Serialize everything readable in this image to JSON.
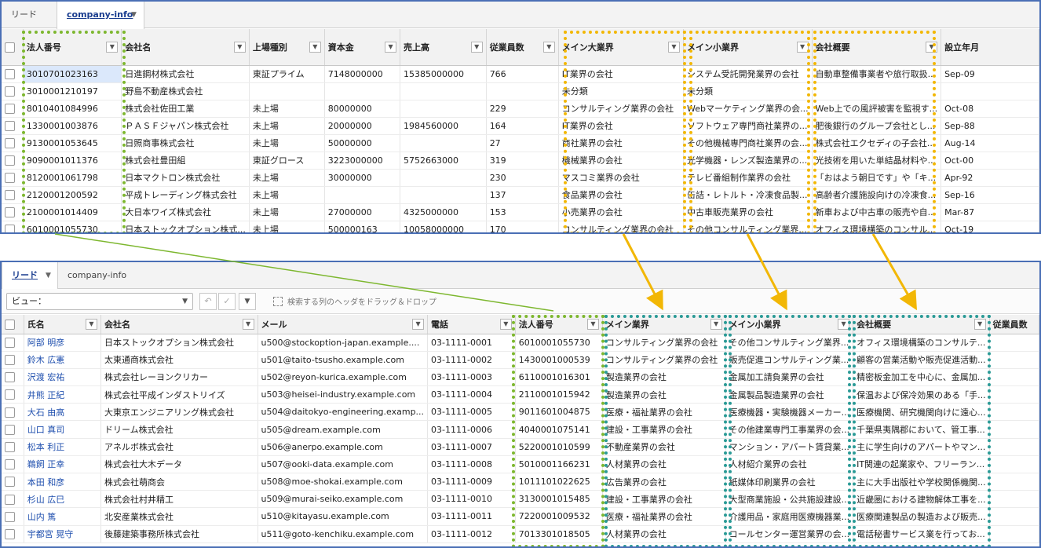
{
  "colors": {
    "green_highlight": "#7db72f",
    "yellow_highlight": "#f2b705",
    "teal_highlight": "#2a9a96",
    "panel_border": "#4a6fb5",
    "link": "#1f4fae"
  },
  "top": {
    "tabs": [
      {
        "label": "リード"
      },
      {
        "label": "company-info"
      }
    ],
    "columns": [
      "法人番号",
      "会社名",
      "上場種別",
      "資本金",
      "売上高",
      "従業員数",
      "メイン大業界",
      "メイン小業界",
      "会社概要",
      "設立年月"
    ],
    "rows": [
      [
        "3010701023163",
        "日進鋼材株式会社",
        "東証プライム",
        "7148000000",
        "15385000000",
        "766",
        "IT業界の会社",
        "システム受託開発業界の会社",
        "自動車整備事業者や旅行取扱...",
        "Sep-09"
      ],
      [
        "3010001210197",
        "野島不動産株式会社",
        "",
        "",
        "",
        "",
        "未分類",
        "未分類",
        "",
        ""
      ],
      [
        "8010401084996",
        "株式会社佐田工業",
        "未上場",
        "80000000",
        "",
        "229",
        "コンサルティング業界の会社",
        "Webマーケティング業界の会...",
        "Web上での風評被害を監視す...",
        "Oct-08"
      ],
      [
        "1330001003876",
        "ＰＡＳＦジャパン株式会社",
        "未上場",
        "20000000",
        "1984560000",
        "164",
        "IT業界の会社",
        "ソフトウェア専門商社業界の...",
        "肥後銀行のグループ会社とし...",
        "Sep-88"
      ],
      [
        "9130001053645",
        "日照商事株式会社",
        "未上場",
        "50000000",
        "",
        "27",
        "商社業界の会社",
        "その他機械専門商社業界の会...",
        "株式会社エクセディの子会社...",
        "Aug-14"
      ],
      [
        "9090001011376",
        "株式会社豊田組",
        "東証グロース",
        "3223000000",
        "5752663000",
        "319",
        "機械業界の会社",
        "光学機器・レンズ製造業界の...",
        "光技術を用いた単結晶材料や...",
        "Oct-00"
      ],
      [
        "8120001061798",
        "日本マクトロン株式会社",
        "未上場",
        "30000000",
        "",
        "230",
        "マスコミ業界の会社",
        "テレビ番組制作業界の会社",
        "「おはよう朝日です」や「キ...",
        "Apr-92"
      ],
      [
        "2120001200592",
        "平成トレーディング株式会社",
        "未上場",
        "",
        "",
        "137",
        "食品業界の会社",
        "缶詰・レトルト・冷凍食品製...",
        "高齢者介護施設向けの冷凍食...",
        "Sep-16"
      ],
      [
        "2100001014409",
        "大日本ワイズ株式会社",
        "未上場",
        "27000000",
        "4325000000",
        "153",
        "小売業界の会社",
        "中古車販売業界の会社",
        "新車および中古車の販売や自...",
        "Mar-87"
      ],
      [
        "6010001055730",
        "日本ストックオプション株式...",
        "未上場",
        "500000163",
        "10058000000",
        "170",
        "コンサルティング業界の会社",
        "その他コンサルティング業界...",
        "オフィス環境構築のコンサル...",
        "Oct-19"
      ]
    ]
  },
  "bottom": {
    "tabs": [
      {
        "label": "リード"
      },
      {
        "label": "company-info"
      }
    ],
    "view_label": "ビュー：",
    "drag_hint": "検索する列のヘッダをドラッグ＆ドロップ",
    "columns": [
      "氏名",
      "会社名",
      "メール",
      "電話",
      "法人番号",
      "メイン業界",
      "メイン小業界",
      "会社概要",
      "従業員数"
    ],
    "rows": [
      [
        "阿部 明彦",
        "日本ストックオプション株式会社",
        "u500@stockoption-japan.example....",
        "03-1111-0001",
        "6010001055730",
        "コンサルティング業界の会社",
        "その他コンサルティング業界...",
        "オフィス環境構築のコンサルテ...",
        ""
      ],
      [
        "鈴木 広憲",
        "太東通商株式会社",
        "u501@taito-tsusho.example.com",
        "03-1111-0002",
        "1430001000539",
        "コンサルティング業界の会社",
        "販売促進コンサルティング業...",
        "顧客の営業活動や販売促進活動...",
        ""
      ],
      [
        "沢渡 宏祐",
        "株式会社レーヨンクリカー",
        "u502@reyon-kurica.example.com",
        "03-1111-0003",
        "6110001016301",
        "製造業界の会社",
        "金属加工請負業界の会社",
        "精密板金加工を中心に、金属加...",
        ""
      ],
      [
        "井熊 正紀",
        "株式会社平成インダストリイズ",
        "u503@heisei-industry.example.com",
        "03-1111-0004",
        "2110001015942",
        "製造業界の会社",
        "金属製品製造業界の会社",
        "保温および保冷効果のある「手...",
        ""
      ],
      [
        "大石 由高",
        "大東京エンジニアリング株式会社",
        "u504@daitokyo-engineering.examp...",
        "03-1111-0005",
        "9011601004875",
        "医療・福祉業界の会社",
        "医療機器・実験機器メーカー...",
        "医療機関、研究機関向けに遠心...",
        ""
      ],
      [
        "山口 真司",
        "ドリーム株式会社",
        "u505@dream.example.com",
        "03-1111-0006",
        "4040001075141",
        "建設・工事業界の会社",
        "その他建業専門工事業界の会...",
        "千葉県夷隅郡において、管工事...",
        ""
      ],
      [
        "松本 利正",
        "アネルボ株式会社",
        "u506@anerpo.example.com",
        "03-1111-0007",
        "5220001010599",
        "不動産業界の会社",
        "マンション・アパート賃貸業...",
        "主に学生向けのアパートやマン...",
        ""
      ],
      [
        "鵜飼 正幸",
        "株式会社大木データ",
        "u507@ooki-data.example.com",
        "03-1111-0008",
        "5010001166231",
        "人材業界の会社",
        "人材紹介業界の会社",
        "IT関連の起業家や、フリーラン...",
        ""
      ],
      [
        "本田 和彦",
        "株式会社萌商会",
        "u508@moe-shokai.example.com",
        "03-1111-0009",
        "1011101022625",
        "広告業界の会社",
        "紙媒体印刷業界の会社",
        "主に大手出版社や学校関係機関...",
        ""
      ],
      [
        "杉山 広巳",
        "株式会社村井精工",
        "u509@murai-seiko.example.com",
        "03-1111-0010",
        "3130001015485",
        "建設・工事業界の会社",
        "大型商業施設・公共施設建設...",
        "近畿圏における建物解体工事を...",
        ""
      ],
      [
        "山内 篤",
        "北安産業株式会社",
        "u510@kitayasu.example.com",
        "03-1111-0011",
        "7220001009532",
        "医療・福祉業界の会社",
        "介護用品・家庭用医療機器業...",
        "医療関連製品の製造および販売...",
        ""
      ],
      [
        "宇都宮 晃守",
        "後藤建築事務所株式会社",
        "u511@goto-kenchiku.example.com",
        "03-1111-0012",
        "7013301018505",
        "人材業界の会社",
        "コールセンター運営業界の会...",
        "電話秘書サービス業を行ってお...",
        ""
      ]
    ]
  }
}
